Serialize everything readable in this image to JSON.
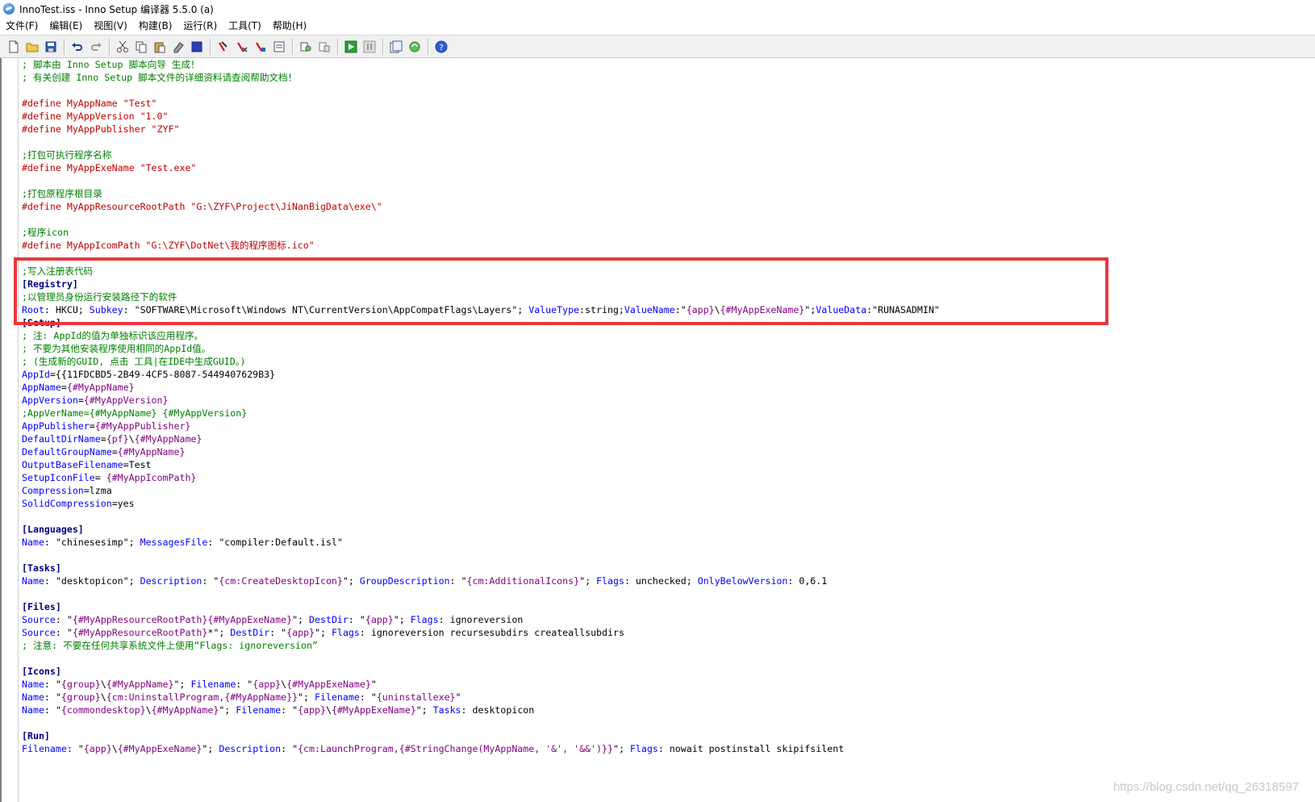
{
  "window": {
    "title": "InnoTest.iss - Inno Setup 编译器 5.5.0 (a)"
  },
  "menu": [
    "文件(F)",
    "编辑(E)",
    "视图(V)",
    "构建(B)",
    "运行(R)",
    "工具(T)",
    "帮助(H)"
  ],
  "toolbar_icons": [
    "new-file-icon",
    "open-folder-icon",
    "save-icon",
    "undo-icon",
    "redo-icon",
    "cut-icon",
    "copy-icon",
    "paste-icon",
    "eraser-icon",
    "select-all-icon",
    "compile-icon",
    "stop-compile-icon",
    "clean-icon",
    "output-icon",
    "find-icon",
    "replace-icon",
    "run-icon",
    "pause-icon",
    "wizard-icon",
    "refresh-icon",
    "help-icon"
  ],
  "code": [
    [
      [
        "c",
        "; 脚本由 Inno Setup 脚本向导 生成！"
      ]
    ],
    [
      [
        "c",
        "; 有关创建 Inno Setup 脚本文件的详细资料请查阅帮助文档！"
      ]
    ],
    [],
    [
      [
        "d",
        "#define MyAppName \"Test\""
      ]
    ],
    [
      [
        "d",
        "#define MyAppVersion \"1.0\""
      ]
    ],
    [
      [
        "d",
        "#define MyAppPublisher \"ZYF\""
      ]
    ],
    [],
    [
      [
        "c",
        ";打包可执行程序名称"
      ]
    ],
    [
      [
        "d",
        "#define MyAppExeName \"Test.exe\""
      ]
    ],
    [],
    [
      [
        "c",
        ";打包原程序根目录"
      ]
    ],
    [
      [
        "d",
        "#define MyAppResourceRootPath \"G:\\ZYF\\Project\\JiNanBigData\\exe\\\""
      ]
    ],
    [],
    [
      [
        "c",
        ";程序icon"
      ]
    ],
    [
      [
        "d",
        "#define MyAppIcomPath \"G:\\ZYF\\DotNet\\我的程序图标.ico\""
      ]
    ],
    [],
    [
      [
        "c",
        ";写入注册表代码"
      ]
    ],
    [
      [
        "s",
        "[Registry]"
      ]
    ],
    [
      [
        "c",
        ";以管理员身份运行安装路径下的软件"
      ]
    ],
    [
      [
        "k",
        "Root"
      ],
      [
        "p",
        ": HKCU; "
      ],
      [
        "k",
        "Subkey"
      ],
      [
        "p",
        ": \"SOFTWARE\\Microsoft\\Windows NT\\CurrentVersion\\AppCompatFlags\\Layers\"; "
      ],
      [
        "k",
        "ValueType"
      ],
      [
        "p",
        ":string;"
      ],
      [
        "k",
        "ValueName"
      ],
      [
        "p",
        ":\""
      ],
      [
        "cn",
        "{app}"
      ],
      [
        "p",
        "\\"
      ],
      [
        "cn",
        "{#MyAppExeName}"
      ],
      [
        "p",
        "\";"
      ],
      [
        "k",
        "ValueData"
      ],
      [
        "p",
        ":\"RUNASADMIN\""
      ]
    ],
    [
      [
        "s",
        "[Setup]"
      ]
    ],
    [
      [
        "c",
        "; 注: AppId的值为单独标识该应用程序。"
      ]
    ],
    [
      [
        "c",
        "; 不要为其他安装程序使用相同的AppId值。"
      ]
    ],
    [
      [
        "c",
        "; (生成新的GUID, 点击 工具|在IDE中生成GUID。)"
      ]
    ],
    [
      [
        "k",
        "AppId"
      ],
      [
        "p",
        "={{11FDCBD5-2B49-4CF5-8087-5449407629B3}"
      ]
    ],
    [
      [
        "k",
        "AppName"
      ],
      [
        "p",
        "="
      ],
      [
        "cn",
        "{#MyAppName}"
      ]
    ],
    [
      [
        "k",
        "AppVersion"
      ],
      [
        "p",
        "="
      ],
      [
        "cn",
        "{#MyAppVersion}"
      ]
    ],
    [
      [
        "c",
        ";AppVerName={#MyAppName} {#MyAppVersion}"
      ]
    ],
    [
      [
        "k",
        "AppPublisher"
      ],
      [
        "p",
        "="
      ],
      [
        "cn",
        "{#MyAppPublisher}"
      ]
    ],
    [
      [
        "k",
        "DefaultDirName"
      ],
      [
        "p",
        "="
      ],
      [
        "cn",
        "{pf}"
      ],
      [
        "p",
        "\\"
      ],
      [
        "cn",
        "{#MyAppName}"
      ]
    ],
    [
      [
        "k",
        "DefaultGroupName"
      ],
      [
        "p",
        "="
      ],
      [
        "cn",
        "{#MyAppName}"
      ]
    ],
    [
      [
        "k",
        "OutputBaseFilename"
      ],
      [
        "p",
        "=Test"
      ]
    ],
    [
      [
        "k",
        "SetupIconFile"
      ],
      [
        "p",
        "= "
      ],
      [
        "cn",
        "{#MyAppIcomPath}"
      ]
    ],
    [
      [
        "k",
        "Compression"
      ],
      [
        "p",
        "=lzma"
      ]
    ],
    [
      [
        "k",
        "SolidCompression"
      ],
      [
        "p",
        "=yes"
      ]
    ],
    [],
    [
      [
        "s",
        "[Languages]"
      ]
    ],
    [
      [
        "k",
        "Name"
      ],
      [
        "p",
        ": \"chinesesimp\"; "
      ],
      [
        "k",
        "MessagesFile"
      ],
      [
        "p",
        ": \"compiler:Default.isl\""
      ]
    ],
    [],
    [
      [
        "s",
        "[Tasks]"
      ]
    ],
    [
      [
        "k",
        "Name"
      ],
      [
        "p",
        ": \"desktopicon\"; "
      ],
      [
        "k",
        "Description"
      ],
      [
        "p",
        ": \""
      ],
      [
        "cn",
        "{cm:CreateDesktopIcon}"
      ],
      [
        "p",
        "\"; "
      ],
      [
        "k",
        "GroupDescription"
      ],
      [
        "p",
        ": \""
      ],
      [
        "cn",
        "{cm:AdditionalIcons}"
      ],
      [
        "p",
        "\"; "
      ],
      [
        "k",
        "Flags"
      ],
      [
        "p",
        ": unchecked; "
      ],
      [
        "k",
        "OnlyBelowVersion"
      ],
      [
        "p",
        ": 0,6.1"
      ]
    ],
    [],
    [
      [
        "s",
        "[Files]"
      ]
    ],
    [
      [
        "k",
        "Source"
      ],
      [
        "p",
        ": \""
      ],
      [
        "cn",
        "{#MyAppResourceRootPath}{#MyAppExeName}"
      ],
      [
        "p",
        "\"; "
      ],
      [
        "k",
        "DestDir"
      ],
      [
        "p",
        ": \""
      ],
      [
        "cn",
        "{app}"
      ],
      [
        "p",
        "\"; "
      ],
      [
        "k",
        "Flags"
      ],
      [
        "p",
        ": ignoreversion"
      ]
    ],
    [
      [
        "k",
        "Source"
      ],
      [
        "p",
        ": \""
      ],
      [
        "cn",
        "{#MyAppResourceRootPath}"
      ],
      [
        "p",
        "*\"; "
      ],
      [
        "k",
        "DestDir"
      ],
      [
        "p",
        ": \""
      ],
      [
        "cn",
        "{app}"
      ],
      [
        "p",
        "\"; "
      ],
      [
        "k",
        "Flags"
      ],
      [
        "p",
        ": ignoreversion recursesubdirs createallsubdirs"
      ]
    ],
    [
      [
        "c",
        "; 注意: 不要在任何共享系统文件上使用“Flags: ignoreversion”"
      ]
    ],
    [],
    [
      [
        "s",
        "[Icons]"
      ]
    ],
    [
      [
        "k",
        "Name"
      ],
      [
        "p",
        ": \""
      ],
      [
        "cn",
        "{group}"
      ],
      [
        "p",
        "\\"
      ],
      [
        "cn",
        "{#MyAppName}"
      ],
      [
        "p",
        "\"; "
      ],
      [
        "k",
        "Filename"
      ],
      [
        "p",
        ": \""
      ],
      [
        "cn",
        "{app}"
      ],
      [
        "p",
        "\\"
      ],
      [
        "cn",
        "{#MyAppExeName}"
      ],
      [
        "p",
        "\""
      ]
    ],
    [
      [
        "k",
        "Name"
      ],
      [
        "p",
        ": \""
      ],
      [
        "cn",
        "{group}"
      ],
      [
        "p",
        "\\"
      ],
      [
        "cn",
        "{cm:UninstallProgram,{#MyAppName}}"
      ],
      [
        "p",
        "\"; "
      ],
      [
        "k",
        "Filename"
      ],
      [
        "p",
        ": \""
      ],
      [
        "cn",
        "{uninstallexe}"
      ],
      [
        "p",
        "\""
      ]
    ],
    [
      [
        "k",
        "Name"
      ],
      [
        "p",
        ": \""
      ],
      [
        "cn",
        "{commondesktop}"
      ],
      [
        "p",
        "\\"
      ],
      [
        "cn",
        "{#MyAppName}"
      ],
      [
        "p",
        "\"; "
      ],
      [
        "k",
        "Filename"
      ],
      [
        "p",
        ": \""
      ],
      [
        "cn",
        "{app}"
      ],
      [
        "p",
        "\\"
      ],
      [
        "cn",
        "{#MyAppExeName}"
      ],
      [
        "p",
        "\"; "
      ],
      [
        "k",
        "Tasks"
      ],
      [
        "p",
        ": desktopicon"
      ]
    ],
    [],
    [
      [
        "s",
        "[Run]"
      ]
    ],
    [
      [
        "k",
        "Filename"
      ],
      [
        "p",
        ": \""
      ],
      [
        "cn",
        "{app}"
      ],
      [
        "p",
        "\\"
      ],
      [
        "cn",
        "{#MyAppExeName}"
      ],
      [
        "p",
        "\"; "
      ],
      [
        "k",
        "Description"
      ],
      [
        "p",
        ": \""
      ],
      [
        "cn",
        "{cm:LaunchProgram,{#StringChange(MyAppName, '&', '&&')}}"
      ],
      [
        "p",
        "\"; "
      ],
      [
        "k",
        "Flags"
      ],
      [
        "p",
        ": nowait postinstall skipifsilent"
      ]
    ]
  ],
  "watermark": "https://blog.csdn.net/qq_26318597"
}
